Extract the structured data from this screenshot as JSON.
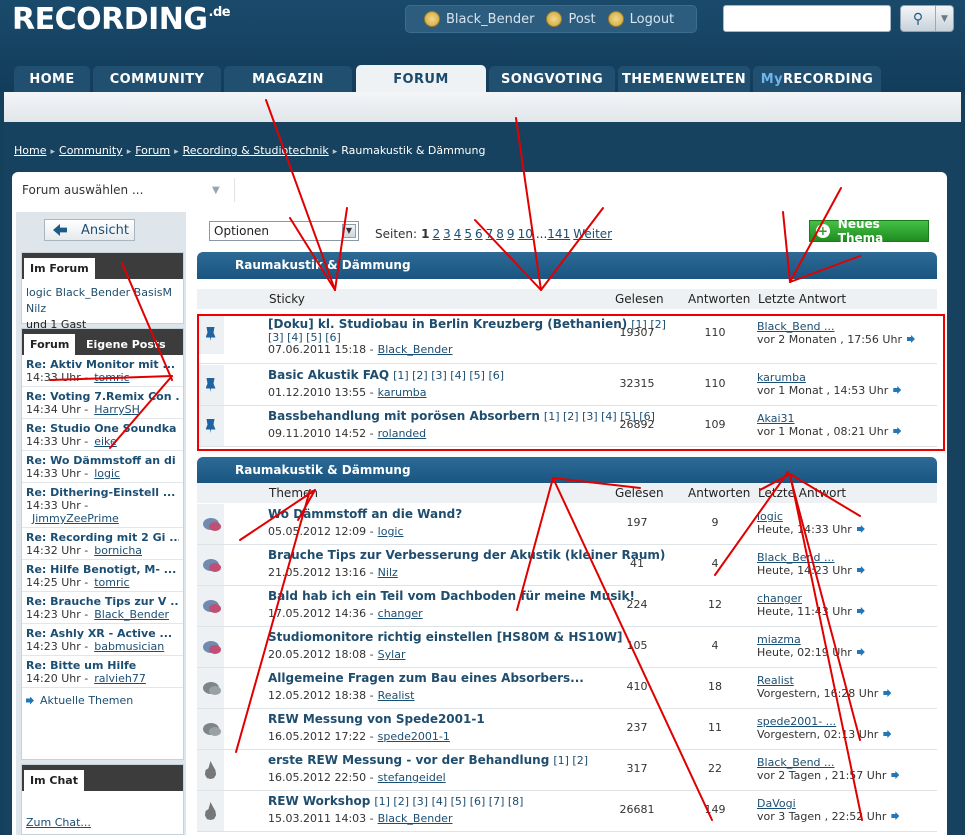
{
  "header": {
    "logo_text": "RECORDING",
    "logo_suffix": ".de",
    "user": "Black_Bender",
    "post_label": "Post",
    "logout_label": "Logout"
  },
  "tabs": [
    "HOME",
    "COMMUNITY",
    "MAGAZIN",
    "FORUM",
    "SONGVOTING",
    "THEMENWELTEN"
  ],
  "tab_my_prefix": "My",
  "tab_my_rest": "RECORDING",
  "active_tab": "FORUM",
  "breadcrumb": [
    "Home",
    "Community",
    "Forum",
    "Recording & Studiotechnik",
    "Raumakustik & Dämmung"
  ],
  "forum_select": "Forum auswählen ...",
  "sidebar": {
    "ansicht_label": "Ansicht",
    "im_forum_tab": "Im Forum",
    "im_forum_users": "logic Black_Bender BasisM Nilz",
    "im_forum_guests": "und 1 Gast",
    "tab_forum": "Forum",
    "tab_eigene": "Eigene Posts",
    "posts": [
      {
        "title": "Re: Aktiv Monitor mit ...",
        "time": "14:33 Uhr -",
        "user": "tomric"
      },
      {
        "title": "Re: Voting 7.Remix Con ...",
        "time": "14:34 Uhr -",
        "user": "HarrySH"
      },
      {
        "title": "Re: Studio One Soundka ...",
        "time": "14:33 Uhr -",
        "user": "eike"
      },
      {
        "title": "Re: Wo Dämmstoff an di ...",
        "time": "14:33 Uhr -",
        "user": "logic"
      },
      {
        "title": "Re: Dithering-Einstell ...",
        "time": "14:33 Uhr -",
        "user": "JimmyZeePrime"
      },
      {
        "title": "Re: Recording mit 2 Gi ...",
        "time": "14:32 Uhr -",
        "user": "bornicha"
      },
      {
        "title": "Re: Hilfe Benotigt, M- ...",
        "time": "14:25 Uhr -",
        "user": "tomric"
      },
      {
        "title": "Re: Brauche Tips zur V ...",
        "time": "14:23 Uhr -",
        "user": "Black_Bender"
      },
      {
        "title": "Re: Ashly XR - Active ...",
        "time": "14:23 Uhr -",
        "user": "babmusician"
      },
      {
        "title": "Re: Bitte um Hilfe",
        "time": "14:20 Uhr -",
        "user": "ralvieh77"
      }
    ],
    "aktuelle_label": "Aktuelle Themen",
    "im_chat_tab": "Im Chat",
    "zum_chat": "Zum Chat..."
  },
  "toolbar": {
    "options_label": "Optionen",
    "pages_label": "Seiten:",
    "current_page": "1",
    "pages": [
      "2",
      "3",
      "4",
      "5",
      "6",
      "7",
      "8",
      "9",
      "10"
    ],
    "ellipsis": "...",
    "last_page": "141",
    "next_label": "Weiter",
    "new_thread_label": "Neues Thema"
  },
  "sections": {
    "title1": "Raumakustik & Dämmung",
    "title2": "Raumakustik & Dämmung",
    "col_sticky": "Sticky",
    "col_themen": "Themen",
    "col_gelesen": "Gelesen",
    "col_antworten": "Antworten",
    "col_letzte": "Letzte Antwort"
  },
  "sticky": [
    {
      "title": "[Doku] kl. Studiobau in Berlin Kreuzberg (Bethanien)",
      "pages1": "[1] [2]",
      "pages2": "[3] [4] [5] [6]",
      "date": "07.06.2011 15:18 -",
      "user": "Black_Bender",
      "gelesen": "19307",
      "antworten": "110",
      "last_user": "Black_Bend ...",
      "last_time": "vor 2 Monaten , 17:56 Uhr"
    },
    {
      "title": "Basic Akustik FAQ",
      "pages1": "[1] [2] [3] [4] [5] [6]",
      "pages2": "",
      "date": "01.12.2010 13:55 -",
      "user": "karumba",
      "gelesen": "32315",
      "antworten": "110",
      "last_user": "karumba",
      "last_time": "vor 1 Monat , 14:53 Uhr"
    },
    {
      "title": "Bassbehandlung mit porösen Absorbern",
      "pages1": "[1] [2] [3] [4] [5] [6]",
      "pages2": "",
      "date": "09.11.2010 14:52 -",
      "user": "rolanded",
      "gelesen": "26892",
      "antworten": "109",
      "last_user": "Akai31",
      "last_time": "vor 1 Monat , 08:21 Uhr"
    }
  ],
  "threads": [
    {
      "title": "Wo Dämmstoff an die Wand?",
      "pages": "",
      "date": "05.05.2012 12:09 -",
      "user": "logic",
      "gelesen": "197",
      "antworten": "9",
      "last_user": "logic",
      "last_time": "Heute, 14:33 Uhr",
      "icon": "bubble"
    },
    {
      "title": "Brauche Tips zur Verbesserung der Akustik (kleiner Raum)",
      "pages": "",
      "date": "21.05.2012 13:16 -",
      "user": "Nilz",
      "gelesen": "41",
      "antworten": "4",
      "last_user": "Black_Bend ...",
      "last_time": "Heute, 14:23 Uhr",
      "icon": "bubble"
    },
    {
      "title": "Bald hab ich ein Teil vom Dachboden für meine Musik!",
      "pages": "",
      "date": "17.05.2012 14:36 -",
      "user": "changer",
      "gelesen": "224",
      "antworten": "12",
      "last_user": "changer",
      "last_time": "Heute, 11:43 Uhr",
      "icon": "bubble"
    },
    {
      "title": "Studiomonitore richtig einstellen [HS80M & HS10W]",
      "pages": "",
      "date": "20.05.2012 18:08 -",
      "user": "Sylar",
      "gelesen": "105",
      "antworten": "4",
      "last_user": "miazma",
      "last_time": "Heute, 02:19 Uhr",
      "icon": "bubble"
    },
    {
      "title": "Allgemeine Fragen zum Bau eines Absorbers...",
      "pages": "",
      "date": "12.05.2012 18:38 -",
      "user": "Realist",
      "gelesen": "410",
      "antworten": "18",
      "last_user": "Realist",
      "last_time": "Vorgestern, 16:28 Uhr",
      "icon": "grey"
    },
    {
      "title": "REW Messung von Spede2001-1",
      "pages": "",
      "date": "16.05.2012 17:22 -",
      "user": "spede2001-1",
      "gelesen": "237",
      "antworten": "11",
      "last_user": "spede2001- ...",
      "last_time": "Vorgestern, 02:13 Uhr",
      "icon": "grey"
    },
    {
      "title": "erste REW Messung - vor der Behandlung",
      "pages": "[1] [2]",
      "date": "16.05.2012 22:50 -",
      "user": "stefangeidel",
      "gelesen": "317",
      "antworten": "22",
      "last_user": "Black_Bend ...",
      "last_time": "vor 2 Tagen , 21:57 Uhr",
      "icon": "flame"
    },
    {
      "title": "REW Workshop",
      "pages": "[1] [2] [3] [4] [5] [6] [7] [8]",
      "date": "15.03.2011 14:03 -",
      "user": "Black_Bender",
      "gelesen": "26681",
      "antworten": "149",
      "last_user": "DaVogi",
      "last_time": "vor 3 Tagen , 22:52 Uhr",
      "icon": "flame"
    }
  ],
  "colors": {
    "annotation": "#e00000",
    "header_bg": "#1a4a6b",
    "section_blue": "#1a5582",
    "new_thread_green": "#2b9a2d"
  }
}
